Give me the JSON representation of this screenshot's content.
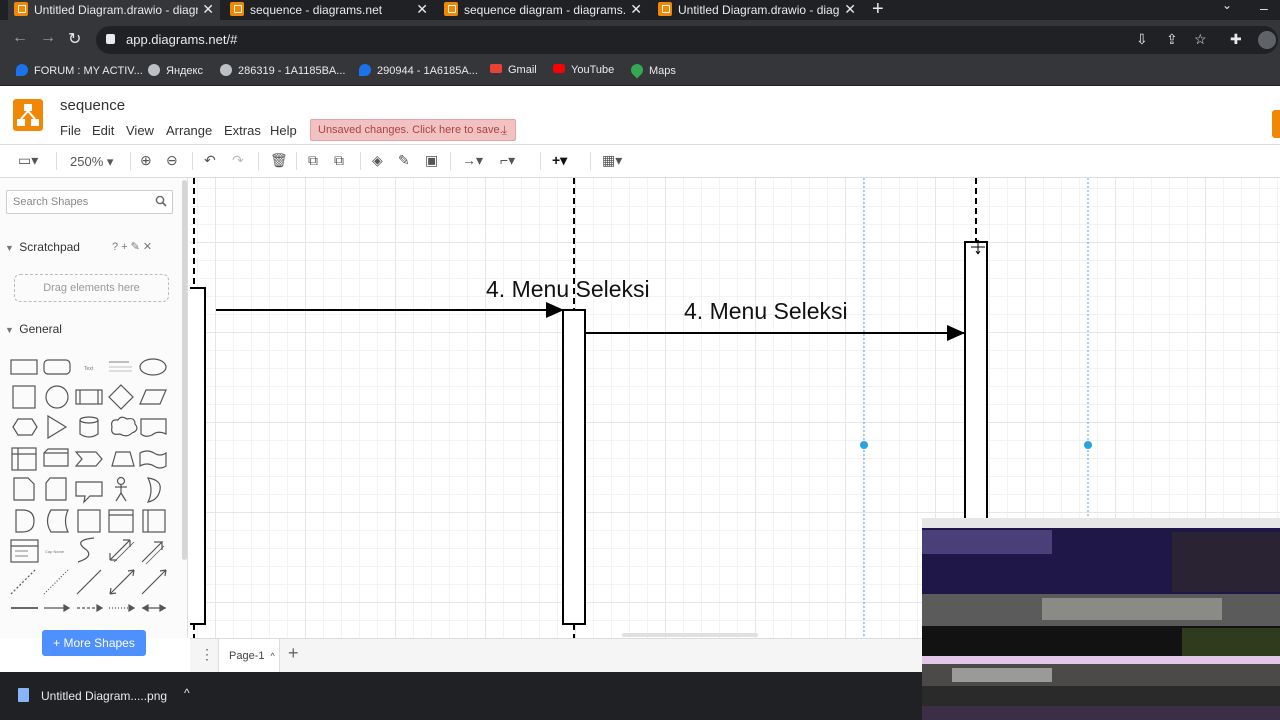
{
  "browser": {
    "tabs": [
      {
        "title": "Untitled Diagram.drawio - diagra",
        "active": true
      },
      {
        "title": "sequence - diagrams.net",
        "active": false
      },
      {
        "title": "sequence diagram - diagrams.ne",
        "active": false
      },
      {
        "title": "Untitled Diagram.drawio - diagra",
        "active": false
      }
    ],
    "url": "app.diagrams.net/#",
    "bookmarks": [
      {
        "label": "FORUM : MY ACTIV...",
        "color": "#1a73e8"
      },
      {
        "label": "Яндекс",
        "color": "#bdc1c6"
      },
      {
        "label": "286319 - 1A1185BA...",
        "color": "#bdc1c6"
      },
      {
        "label": "290944 - 1A6185A...",
        "color": "#1a73e8"
      },
      {
        "label": "Gmail",
        "color": "#ea4335"
      },
      {
        "label": "YouTube",
        "color": "#ff0000"
      },
      {
        "label": "Maps",
        "color": "#34a853"
      }
    ]
  },
  "app": {
    "doc_title": "sequence",
    "menus": [
      "File",
      "Edit",
      "View",
      "Arrange",
      "Extras",
      "Help"
    ],
    "unsaved_notice": "Unsaved changes. Click here to save.",
    "zoom": "250%",
    "accent_color": "#f08705"
  },
  "sidebar": {
    "search_placeholder": "Search Shapes",
    "scratchpad_title": "Scratchpad",
    "scratchpad_actions": "?  +  ✎  ✕",
    "drop_hint": "Drag elements here",
    "general_title": "General",
    "more_shapes": "+ More Shapes"
  },
  "diagram": {
    "messages": [
      {
        "label": "4. Menu Seleksi"
      },
      {
        "label": "4. Menu Seleksi"
      }
    ]
  },
  "pages": {
    "current": "Page-1"
  },
  "downloads": {
    "file": "Untitled Diagram.....png"
  }
}
